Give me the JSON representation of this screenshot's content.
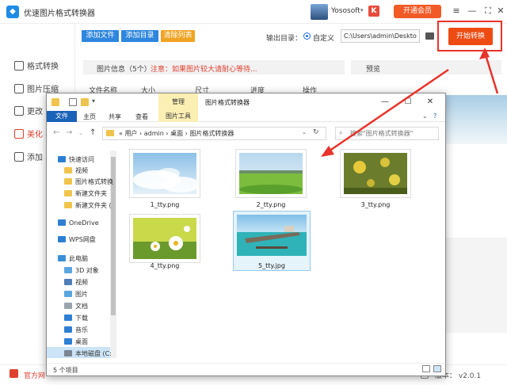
{
  "app": {
    "title": "优速图片格式转换器",
    "user_name": "Yososoft",
    "user_caret": "▾",
    "k_badge": "K",
    "vip_button": "开通会员",
    "controls": [
      "≡",
      "—",
      "⛶",
      "✕"
    ]
  },
  "sidebar": {
    "items": [
      {
        "label": "格式转换",
        "active": false
      },
      {
        "label": "图片压缩",
        "active": false
      },
      {
        "label": "更改",
        "active": false
      },
      {
        "label": "美化",
        "active": true
      },
      {
        "label": "添加",
        "active": false
      }
    ]
  },
  "toolbar": {
    "add_file": "添加文件",
    "add_dir": "添加目录",
    "clear_list": "清除列表",
    "output_label": "输出目录：",
    "radio_label": "自定义",
    "output_path": "C:\\Users\\admin\\Deskto",
    "start_button": "开始转换"
  },
  "info": {
    "label": "图片信息（5个）",
    "warning": "注意：如果图片较大请耐心等待...",
    "preview_label": "预览",
    "columns": [
      "文件名称",
      "大小",
      "尺寸",
      "进度",
      "操作"
    ]
  },
  "footer": {
    "home_text": "官方网",
    "version_label": "版本：",
    "version": "v2.0.1"
  },
  "explorer": {
    "window_title": "图片格式转换器",
    "manage_tab": "管理",
    "ribbon": {
      "file": "文件",
      "tabs": [
        "主页",
        "共享",
        "查看"
      ],
      "picture_tools": "图片工具",
      "help": "?"
    },
    "address": {
      "path": "«  用户  ›  admin  ›  桌面  ›  图片格式转换器",
      "caret": "⌄",
      "refresh": "↻"
    },
    "search_placeholder": "搜索\"图片格式转换器\"",
    "nav": [
      {
        "label": "快速访问",
        "icon": "star-icon",
        "color": "#2d7fd3"
      },
      {
        "label": "视频",
        "icon": "folder-icon",
        "color": "#f0c44c"
      },
      {
        "label": "图片格式转换",
        "icon": "folder-icon",
        "color": "#f0c44c"
      },
      {
        "label": "新建文件夹",
        "icon": "folder-icon",
        "color": "#f0c44c"
      },
      {
        "label": "新建文件夹 (",
        "icon": "folder-icon",
        "color": "#f0c44c"
      },
      {
        "label": "OneDrive",
        "icon": "cloud-icon",
        "color": "#2d7fd3"
      },
      {
        "label": "WPS网盘",
        "icon": "cloud-icon",
        "color": "#2d7fd3"
      },
      {
        "label": "此电脑",
        "icon": "computer-icon",
        "color": "#3b8fd6"
      },
      {
        "label": "3D 对象",
        "icon": "cube-icon",
        "color": "#5aa6e0"
      },
      {
        "label": "视频",
        "icon": "video-icon",
        "color": "#4f7fb8"
      },
      {
        "label": "图片",
        "icon": "picture-icon",
        "color": "#5aa6e0"
      },
      {
        "label": "文档",
        "icon": "document-icon",
        "color": "#9aa4b0"
      },
      {
        "label": "下载",
        "icon": "download-icon",
        "color": "#2d7fd3"
      },
      {
        "label": "音乐",
        "icon": "music-icon",
        "color": "#2d7fd3"
      },
      {
        "label": "桌面",
        "icon": "desktop-icon",
        "color": "#2d7fd3"
      },
      {
        "label": "本地磁盘 (C:",
        "icon": "drive-icon",
        "color": "#7a8591"
      }
    ],
    "files": [
      {
        "name": "1_tty.png",
        "kind": "sky",
        "selected": false
      },
      {
        "name": "2_tty.png",
        "kind": "meadow",
        "selected": false
      },
      {
        "name": "3_tty.png",
        "kind": "flowers",
        "selected": false
      },
      {
        "name": "4_tty.png",
        "kind": "daisies",
        "selected": false
      },
      {
        "name": "5_tty.jpg",
        "kind": "pier",
        "selected": true
      }
    ],
    "status": "5 个项目"
  },
  "colors": {
    "accent_red": "#ee4b13",
    "brand_blue": "#1e8ce6",
    "annotation_red": "#e8332b"
  }
}
